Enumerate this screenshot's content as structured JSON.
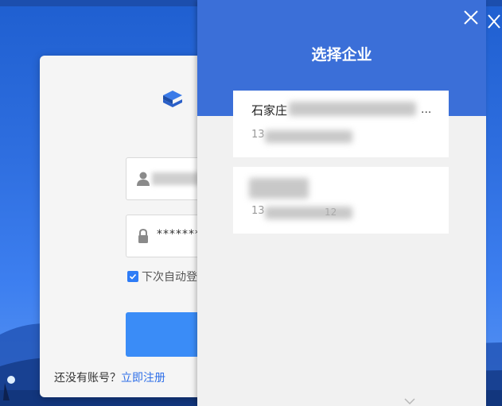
{
  "login": {
    "password_mask": "********",
    "remember_label": "下次自动登",
    "register_prompt": "还没有账号？",
    "register_link": "立即注册"
  },
  "modal": {
    "title": "选择企业",
    "companies": [
      {
        "name": "石家庄",
        "ellipsis": "...",
        "phone_prefix": "13",
        "tail": ""
      },
      {
        "name": "",
        "ellipsis": "",
        "phone_prefix": "13",
        "tail": "12"
      }
    ]
  },
  "icons": {
    "close": "close-icon",
    "user": "user-icon",
    "lock": "lock-icon",
    "check": "check-icon",
    "logo": "app-logo"
  },
  "colors": {
    "modal_header": "#3b6fd8",
    "accent": "#2e6fe8",
    "login_button": "#3a8cf7"
  }
}
